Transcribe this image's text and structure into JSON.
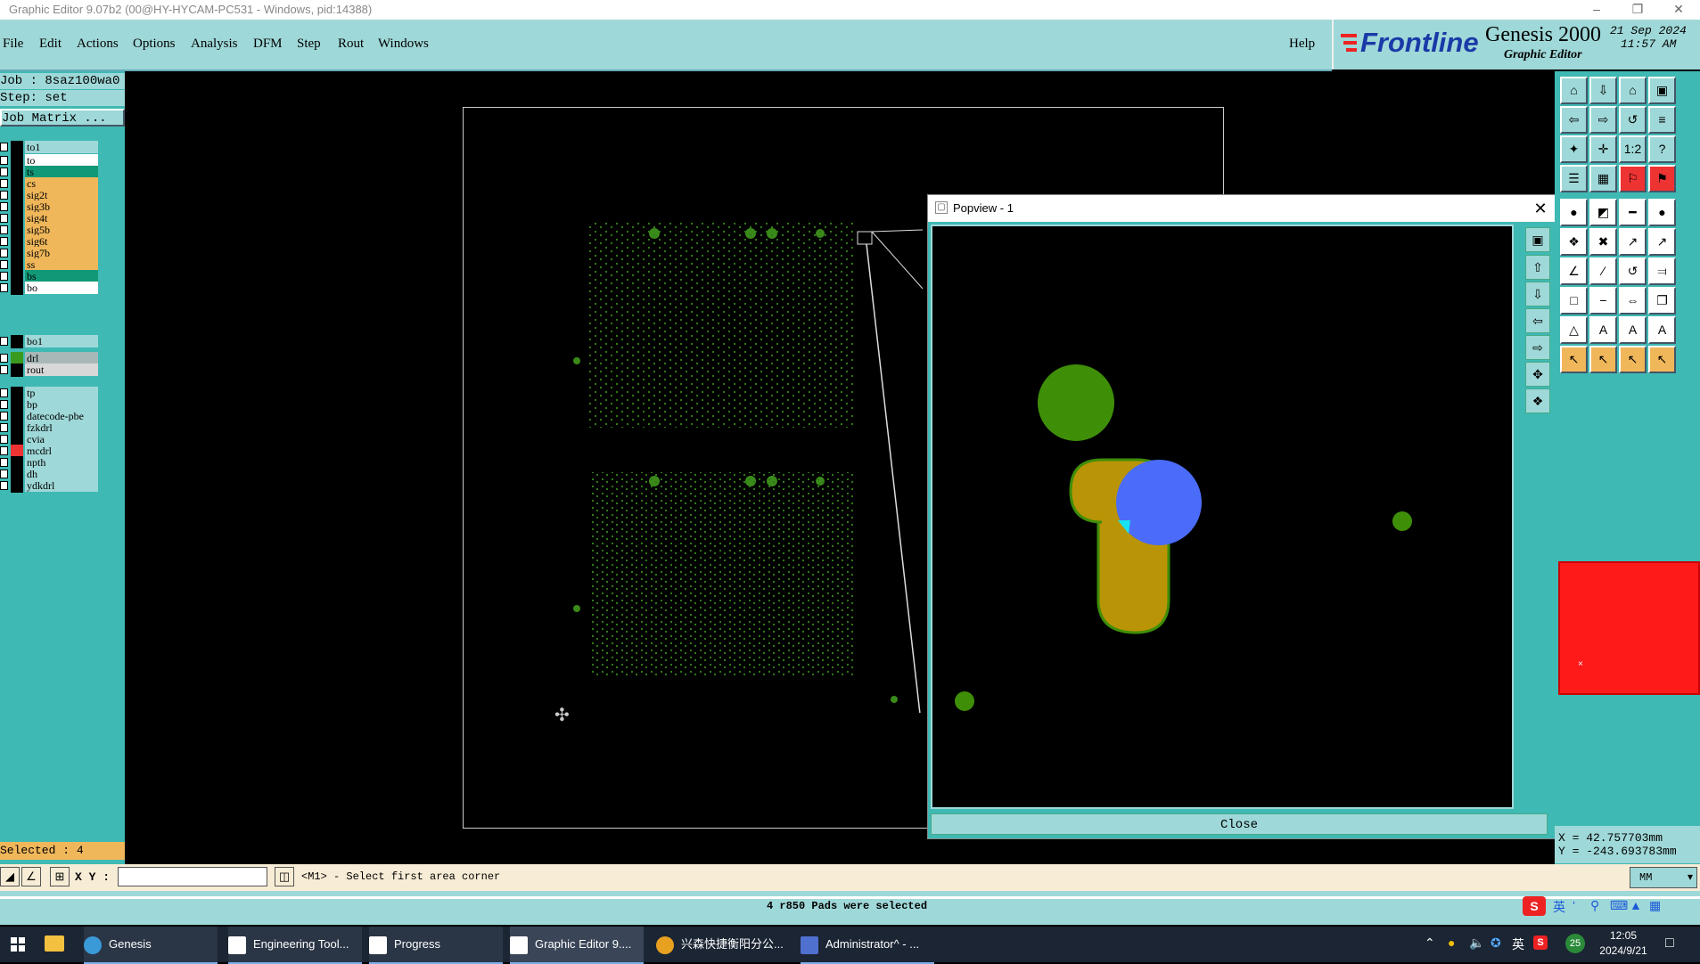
{
  "window": {
    "title": "Graphic Editor 9.07b2 (00@HY-HYCAM-PC531 - Windows, pid:14388)"
  },
  "menu": [
    "File",
    "Edit",
    "Actions",
    "Options",
    "Analysis",
    "DFM",
    "Step",
    "Rout",
    "Windows"
  ],
  "help_label": "Help",
  "brand": {
    "logo": "Frontline",
    "product": "Genesis 2000",
    "subtitle": "Graphic Editor",
    "date": "21 Sep 2024",
    "time": "11:57 AM"
  },
  "job": {
    "job_line": "Job : 8saz100wa0",
    "step_line": "Step: set",
    "matrix_button": "Job Matrix ..."
  },
  "layers": [
    {
      "name": "to1",
      "color": "#9fd8d8",
      "swatch": "#000",
      "group": 0
    },
    {
      "name": "to",
      "color": "#ffffff",
      "swatch": "#000",
      "group": 1
    },
    {
      "name": "ts",
      "color": "#119977",
      "swatch": "#000",
      "group": 1
    },
    {
      "name": "cs",
      "color": "#f0b75a",
      "swatch": "#000",
      "group": 1
    },
    {
      "name": "sig2t",
      "color": "#f0b75a",
      "swatch": "#000",
      "group": 1
    },
    {
      "name": "sig3b",
      "color": "#f0b75a",
      "swatch": "#000",
      "group": 1
    },
    {
      "name": "sig4t",
      "color": "#f0b75a",
      "swatch": "#000",
      "group": 1
    },
    {
      "name": "sig5b",
      "color": "#f0b75a",
      "swatch": "#000",
      "group": 1
    },
    {
      "name": "sig6t",
      "color": "#f0b75a",
      "swatch": "#000",
      "group": 1
    },
    {
      "name": "sig7b",
      "color": "#f0b75a",
      "swatch": "#000",
      "group": 1
    },
    {
      "name": "ss",
      "color": "#f0b75a",
      "swatch": "#000",
      "group": 1
    },
    {
      "name": "bs",
      "color": "#119977",
      "swatch": "#000",
      "group": 1
    },
    {
      "name": "bo",
      "color": "#ffffff",
      "swatch": "#000",
      "group": 1
    },
    {
      "name": "bo1",
      "color": "#9fd8d8",
      "swatch": "#000",
      "group": 2
    },
    {
      "name": "drl",
      "color": "#a8b8b8",
      "swatch": "#3a9a20",
      "group": 3
    },
    {
      "name": "rout",
      "color": "#d8d8d8",
      "swatch": "#000",
      "group": 3
    },
    {
      "name": "tp",
      "color": "#9fd8d8",
      "swatch": "#000",
      "group": 4
    },
    {
      "name": "bp",
      "color": "#9fd8d8",
      "swatch": "#000",
      "group": 4
    },
    {
      "name": "datecode-pbe",
      "color": "#9fd8d8",
      "swatch": "#000",
      "group": 4
    },
    {
      "name": "fzkdrl",
      "color": "#9fd8d8",
      "swatch": "#000",
      "group": 4
    },
    {
      "name": "cvia",
      "color": "#9fd8d8",
      "swatch": "#000",
      "group": 4
    },
    {
      "name": "mcdrl",
      "color": "#9fd8d8",
      "swatch": "#e33",
      "group": 4
    },
    {
      "name": "npth",
      "color": "#9fd8d8",
      "swatch": "#000",
      "group": 4
    },
    {
      "name": "dh",
      "color": "#9fd8d8",
      "swatch": "#000",
      "group": 4
    },
    {
      "name": "ydkdrl",
      "color": "#9fd8d8",
      "swatch": "#000",
      "group": 4
    }
  ],
  "selected_text": "Selected : 4",
  "popview": {
    "title": "Popview - 1",
    "close_label": "Close"
  },
  "coords": {
    "x": "X = 42.757703mm",
    "y": "Y = -243.693783mm"
  },
  "cmd": {
    "xy_label": "X Y :",
    "xy_value": "",
    "prompt": "<M1> - Select first area corner",
    "units": "MM"
  },
  "message": "4 r850 Pads were selected",
  "taskbar": {
    "items": [
      "Genesis",
      "Engineering Tool...",
      "Progress",
      "Graphic Editor 9....",
      "兴森快捷衡阳分公...",
      "Administrator^ - ..."
    ],
    "ime": "英",
    "clock_time": "12:05",
    "clock_date": "2024/9/21",
    "notif_count": "25"
  }
}
